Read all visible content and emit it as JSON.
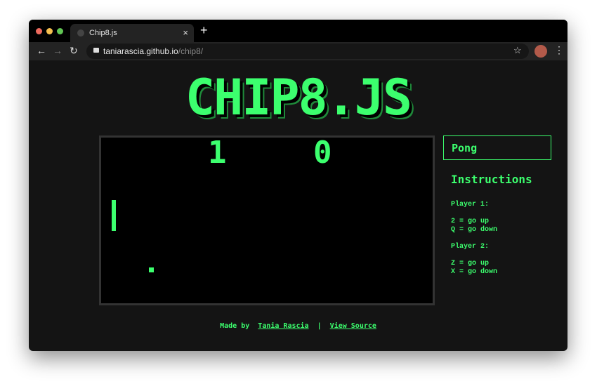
{
  "browser": {
    "tab_title": "Chip8.js",
    "url_host": "taniarascia.github.io",
    "url_path": "/chip8/",
    "close": "×",
    "new_tab": "+",
    "back": "←",
    "forward": "→",
    "reload": "↻",
    "star": "☆",
    "menu": "⋮"
  },
  "page": {
    "title": "CHIP8.JS",
    "scores": [
      "1",
      "0"
    ],
    "rom_select": "Pong",
    "instructions_heading": "Instructions",
    "player1_label": "Player 1:",
    "player1_up": "2 = go up",
    "player1_down": "Q = go down",
    "player2_label": "Player 2:",
    "player2_up": "Z = go up",
    "player2_down": "X = go down",
    "footer": {
      "made_by": "Made by",
      "author": "Tania Rascia",
      "sep": "|",
      "source": "View Source"
    }
  },
  "colors": {
    "accent": "#3cff6e",
    "background": "#141414"
  }
}
